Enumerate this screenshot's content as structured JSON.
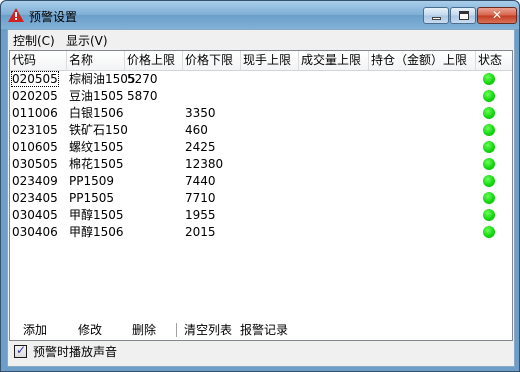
{
  "window": {
    "title": "预警设置",
    "minimize_icon": "minimize-icon",
    "maximize_icon": "maximize-icon",
    "close_icon": "close-icon",
    "close_glyph": "✕"
  },
  "menu": [
    {
      "label": "控制(C)"
    },
    {
      "label": "显示(V)"
    }
  ],
  "table": {
    "columns": [
      "代码",
      "名称",
      "价格上限",
      "价格下限",
      "现手上限",
      "成交量上限",
      "持仓（金额）上限",
      "状态"
    ],
    "rows": [
      {
        "code": "020505",
        "name": "棕榈油1505",
        "upper": "5270",
        "lower": "",
        "status": "green"
      },
      {
        "code": "020205",
        "name": "豆油1505",
        "upper": "5870",
        "lower": "",
        "status": "green"
      },
      {
        "code": "011006",
        "name": "白银1506",
        "upper": "",
        "lower": "3350",
        "status": "green"
      },
      {
        "code": "023105",
        "name": "铁矿石150",
        "upper": "",
        "lower": "460",
        "status": "green"
      },
      {
        "code": "010605",
        "name": "螺纹1505",
        "upper": "",
        "lower": "2425",
        "status": "green"
      },
      {
        "code": "030505",
        "name": "棉花1505",
        "upper": "",
        "lower": "12380",
        "status": "green"
      },
      {
        "code": "023409",
        "name": "PP1509",
        "upper": "",
        "lower": "7440",
        "status": "green"
      },
      {
        "code": "023405",
        "name": "PP1505",
        "upper": "",
        "lower": "7710",
        "status": "green"
      },
      {
        "code": "030405",
        "name": "甲醇1505",
        "upper": "",
        "lower": "1955",
        "status": "green"
      },
      {
        "code": "030406",
        "name": "甲醇1506",
        "upper": "",
        "lower": "2015",
        "status": "green"
      }
    ]
  },
  "toolbar": {
    "add": "添加",
    "edit": "修改",
    "delete": "删除",
    "clear": "清空列表",
    "log": "报警记录"
  },
  "options": {
    "play_sound_label": "预警时播放声音",
    "play_sound_checked": true
  },
  "colors": {
    "status_ok": "#13d70e"
  }
}
